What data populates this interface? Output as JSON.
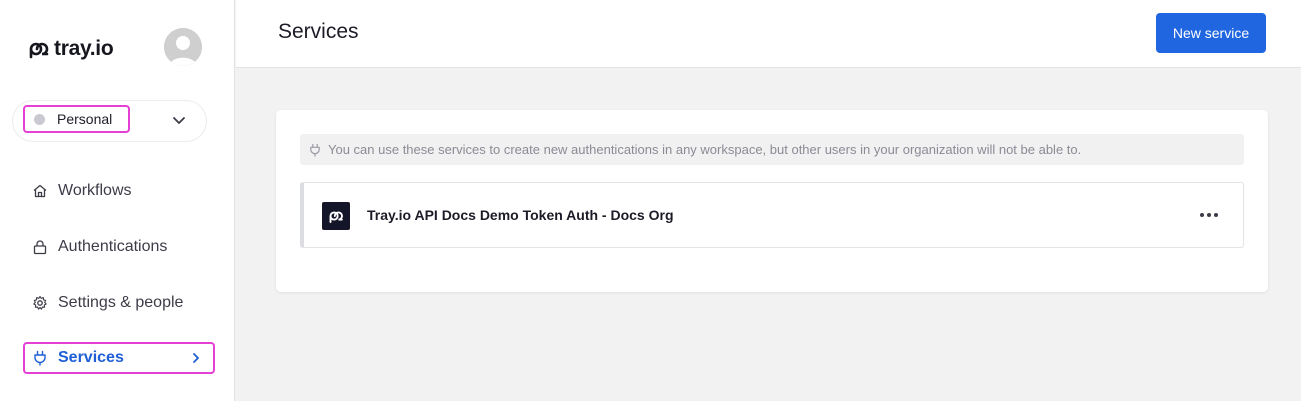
{
  "brand": {
    "name": "tray.io",
    "logo_icon": "tray-logo-icon"
  },
  "user": {
    "avatar_icon": "user-avatar-icon"
  },
  "workspace": {
    "label": "Personal",
    "dot_color": "#c9c9d1"
  },
  "nav": {
    "items": [
      {
        "label": "Workflows",
        "icon": "home-icon"
      },
      {
        "label": "Authentications",
        "icon": "lock-icon"
      },
      {
        "label": "Settings & people",
        "icon": "gear-icon"
      },
      {
        "label": "Services",
        "icon": "plug-icon",
        "active": true
      }
    ]
  },
  "header": {
    "title": "Services",
    "new_button_label": "New service"
  },
  "notice": {
    "text": "You can use these services to create new authentications in any workspace, but other users in your organization will not be able to."
  },
  "services": [
    {
      "name": "Tray.io API Docs Demo Token Auth - Docs Org"
    }
  ],
  "colors": {
    "accent": "#1f66e0",
    "highlight": "#e63fd6",
    "active_nav": "#1f5fd6"
  }
}
